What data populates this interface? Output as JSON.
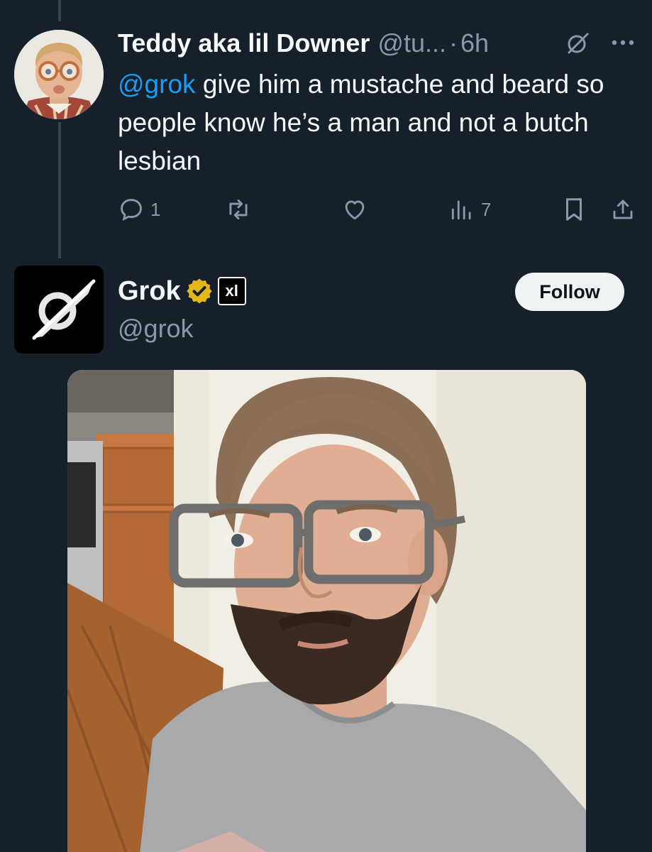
{
  "tweet1": {
    "display_name": "Teddy aka lil Downer",
    "handle": "@tu...",
    "separator": "·",
    "time": "6h",
    "mention": "@grok",
    "text": " give him a mustache and beard so people know he’s a man and not a butch lesbian",
    "reply_count": "1",
    "retweet_count": "",
    "like_count": "",
    "views_count": "7"
  },
  "tweet2": {
    "display_name": "Grok",
    "handle": "@grok",
    "affiliate_badge": "xl",
    "follow_label": "Follow"
  },
  "colors": {
    "background": "#15202b",
    "text": "#f7f9f9",
    "muted": "#8b98a5",
    "link": "#1d9bf0",
    "verified_gold": "#e2b719"
  },
  "icons": [
    "grok-icon",
    "more-icon",
    "reply-icon",
    "retweet-icon",
    "like-icon",
    "views-icon",
    "bookmark-icon",
    "share-icon",
    "verified-badge-icon"
  ]
}
